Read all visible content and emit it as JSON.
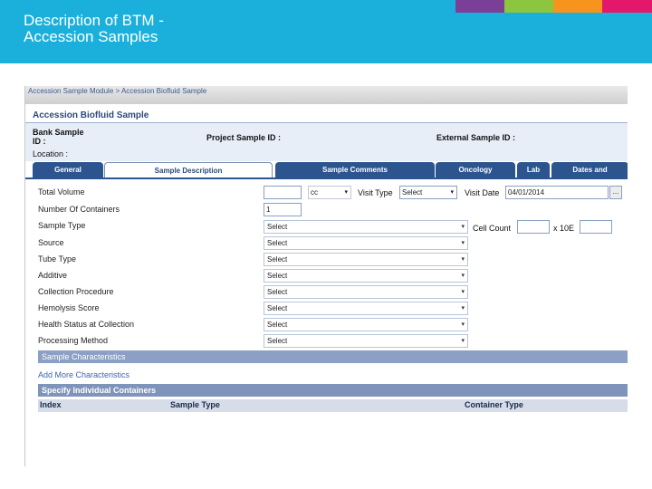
{
  "slide": {
    "title_line1": "Description of BTM -",
    "title_line2": "Accession Samples"
  },
  "colors": {
    "header_bg": "#1bb0dc",
    "stripes": [
      "#7b3f98",
      "#8cc63f",
      "#f7941d",
      "#e4186b"
    ],
    "tab_bg": "#2c5590",
    "section_bar": "#8ba0c4"
  },
  "app": {
    "breadcrumb": "Accession Sample Module > Accession Biofluid Sample",
    "panel_title": "Accession Biofluid Sample",
    "bank_sample_label_1": "Bank Sample",
    "bank_sample_label_2": "ID :",
    "project_sample_label": "Project Sample ID :",
    "external_sample_label": "External Sample ID :",
    "location_label": "Location :"
  },
  "tabs": [
    {
      "label": "General",
      "active": false
    },
    {
      "label": "Sample Description",
      "active": true
    },
    {
      "label": "Sample Comments",
      "active": false
    },
    {
      "label": "Oncology",
      "active": false
    },
    {
      "label": "Lab",
      "active": false
    },
    {
      "label": "Dates and",
      "active": false
    }
  ],
  "form": {
    "total_volume_label": "Total Volume",
    "total_volume_value": "",
    "unit_value": "cc",
    "visit_type_label": "Visit Type",
    "visit_type_value": "Select",
    "visit_date_label": "Visit Date",
    "visit_date_value": "04/01/2014",
    "date_button": "...",
    "num_containers_label": "Number Of Containers",
    "num_containers_value": "1",
    "cell_count_label": "Cell Count",
    "cell_count_mult": "x 10E",
    "selects": [
      {
        "label": "Sample Type",
        "value": "Select"
      },
      {
        "label": "Source",
        "value": "Select"
      },
      {
        "label": "Tube Type",
        "value": "Select"
      },
      {
        "label": "Additive",
        "value": "Select"
      },
      {
        "label": "Collection Procedure",
        "value": "Select"
      },
      {
        "label": "Hemolysis Score",
        "value": "Select"
      },
      {
        "label": "Health Status at Collection",
        "value": "Select"
      },
      {
        "label": "Processing Method",
        "value": "Select"
      }
    ]
  },
  "characteristics": {
    "bar_label": "Sample Characteristics",
    "add_link": "Add More Characteristics"
  },
  "containers": {
    "bar_label": "Specify Individual Containers",
    "columns": [
      "Index",
      "Sample Type",
      "Container Type"
    ]
  }
}
